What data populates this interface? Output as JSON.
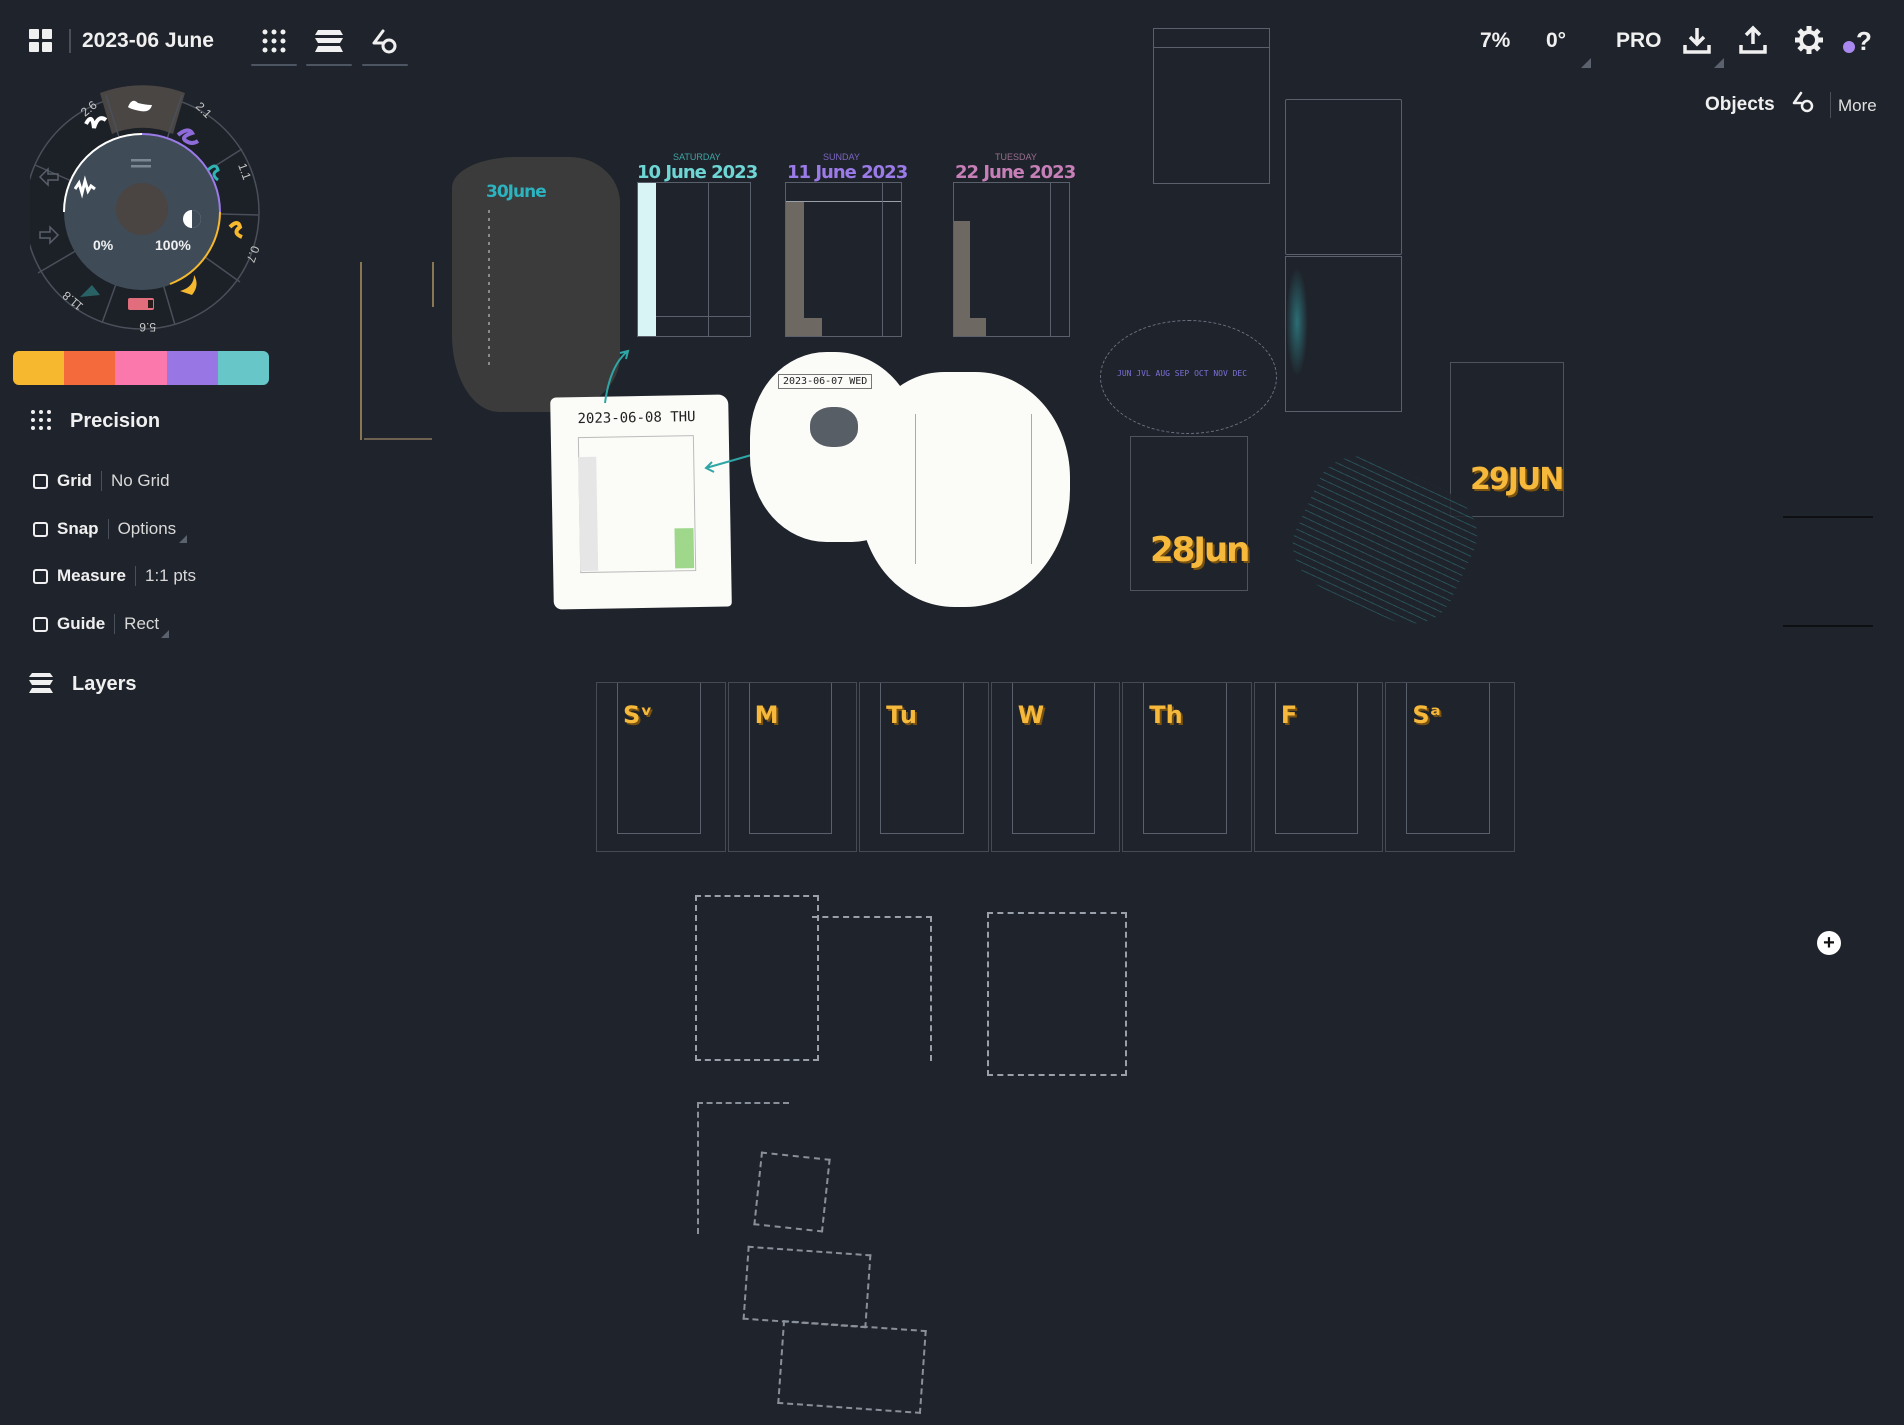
{
  "topbar": {
    "doc_title": "2023-06 June",
    "zoom": "7%",
    "rotation": "0°",
    "pro_label": "PRO",
    "icons": [
      "gallery-icon",
      "precision-icon",
      "layers-icon",
      "objects-icon",
      "import-icon",
      "export-icon",
      "settings-icon",
      "help-icon"
    ]
  },
  "objects_bar": {
    "objects_label": "Objects",
    "more_label": "More"
  },
  "brush_wheel": {
    "tools": [
      {
        "name": "selected-brush",
        "size": ""
      },
      {
        "name": "purple-pen",
        "size": "2.1",
        "color": "#8e6bd8"
      },
      {
        "name": "teal-pen",
        "size": "1.1",
        "color": "#2fb3b3"
      },
      {
        "name": "yellow-marker",
        "size": "0.7",
        "color": "#f5b82e"
      },
      {
        "name": "yellow-fill",
        "size": "",
        "color": "#f5b82e"
      },
      {
        "name": "eraser",
        "size": "5.6",
        "color": "#e26d7c"
      },
      {
        "name": "airbrush",
        "size": "11.8",
        "color": "#2f8f8f"
      },
      {
        "name": "white-pen",
        "size": "2.6",
        "color": "#ffffff"
      }
    ],
    "smoothing": "0%",
    "opacity": "100%"
  },
  "palette": [
    "#f5b82e",
    "#f46a3c",
    "#fa78ac",
    "#9876e4",
    "#66c6c8"
  ],
  "precision": {
    "title": "Precision",
    "rows": [
      {
        "label": "Grid",
        "value": "No Grid"
      },
      {
        "label": "Snap",
        "value": "Options"
      },
      {
        "label": "Measure",
        "value": "1:1 pts"
      },
      {
        "label": "Guide",
        "value": "Rect"
      }
    ]
  },
  "layers": {
    "title": "Layers"
  },
  "canvas": {
    "date_headers": [
      {
        "text": "30June",
        "color": "#2bb3c0"
      },
      {
        "sub": "SATURDAY",
        "text": "10 June 2023",
        "color": "#6fd6d6"
      },
      {
        "sub": "SUNDAY",
        "text": "11 June 2023",
        "color": "#9b7be8"
      },
      {
        "sub": "TUESDAY",
        "text": "22 June 2023",
        "color": "#c77fb8"
      }
    ],
    "note_thu": "2023-06-08 THU",
    "note_wed": "2023-06-07 WED",
    "months_line": "JUN JVL AUG SEP OCT NOV DEC",
    "big_dates": [
      "28Jun",
      "29JUN"
    ],
    "weekdays": [
      "Sᵛ",
      "M",
      "Tu",
      "W",
      "Th",
      "F",
      "Sᵃ"
    ]
  }
}
